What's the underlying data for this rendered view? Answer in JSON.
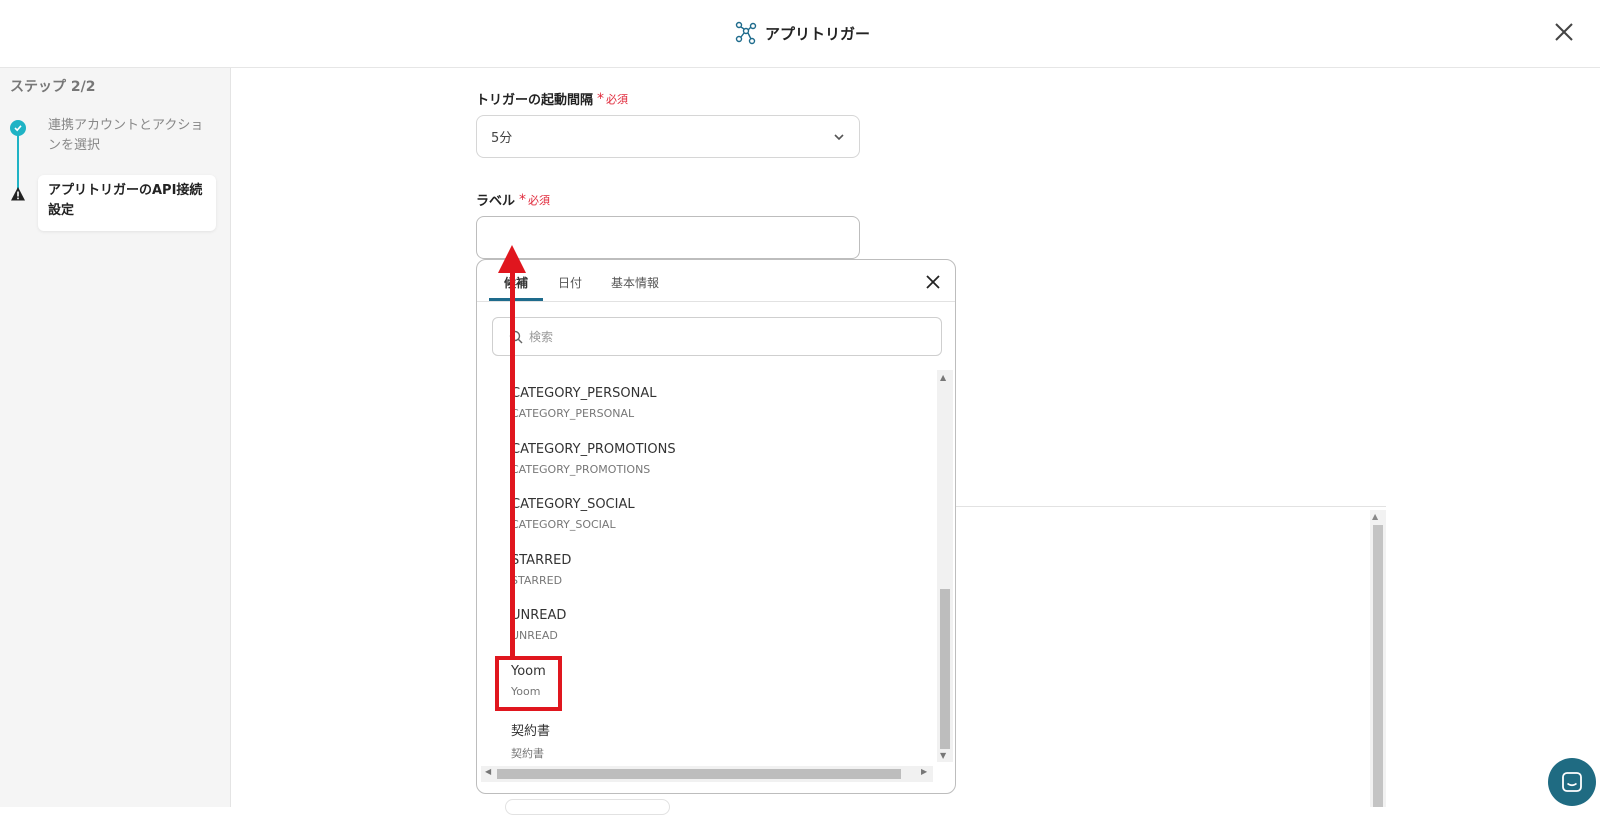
{
  "header": {
    "title": "アプリトリガー"
  },
  "sidebar": {
    "step_title": "ステップ 2/2",
    "steps": [
      {
        "label": "連携アカウントとアクションを選択",
        "status": "done"
      },
      {
        "label": "アプリトリガーのAPI接続設定",
        "status": "current"
      }
    ]
  },
  "form": {
    "interval": {
      "label": "トリガーの起動間隔",
      "required": "必須",
      "value": "5分"
    },
    "label_field": {
      "label": "ラベル",
      "required": "必須",
      "value": ""
    }
  },
  "popup": {
    "tabs": [
      "候補",
      "日付",
      "基本情報"
    ],
    "active_tab": "候補",
    "search_placeholder": "検索",
    "items": [
      {
        "main": "CATEGORY_PERSONAL",
        "sub": "CATEGORY_PERSONAL"
      },
      {
        "main": "CATEGORY_PROMOTIONS",
        "sub": "CATEGORY_PROMOTIONS"
      },
      {
        "main": "CATEGORY_SOCIAL",
        "sub": "CATEGORY_SOCIAL"
      },
      {
        "main": "STARRED",
        "sub": "STARRED"
      },
      {
        "main": "UNREAD",
        "sub": "UNREAD"
      },
      {
        "main": "Yoom",
        "sub": "Yoom"
      },
      {
        "main": "契約書",
        "sub": "契約書"
      }
    ]
  },
  "colors": {
    "accent": "#1fb3c5",
    "required": "#e0283a",
    "annotation": "#e0161e",
    "chat": "#1f6b82"
  }
}
